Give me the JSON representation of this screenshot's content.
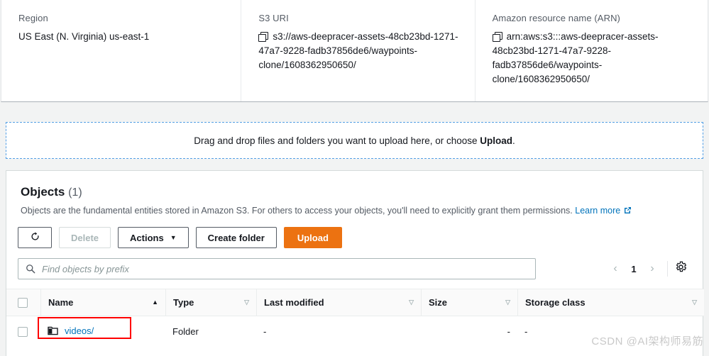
{
  "info": {
    "region": {
      "label": "Region",
      "value": "US East (N. Virginia) us-east-1"
    },
    "s3_uri": {
      "label": "S3 URI",
      "value": "s3://aws-deepracer-assets-48cb23bd-1271-47a7-9228-fadb37856de6/waypoints-clone/1608362950650/",
      "copy_icon": "copy-icon"
    },
    "arn": {
      "label": "Amazon resource name (ARN)",
      "value": "arn:aws:s3:::aws-deepracer-assets-48cb23bd-1271-47a7-9228-fadb37856de6/waypoints-clone/1608362950650/",
      "copy_icon": "copy-icon"
    }
  },
  "dropzone": {
    "text_before": "Drag and drop files and folders you want to upload here, or choose ",
    "emphasis": "Upload",
    "text_after": "."
  },
  "objects": {
    "title": "Objects",
    "count": "(1)",
    "description": "Objects are the fundamental entities stored in Amazon S3. For others to access your objects, you'll need to explicitly grant them permissions.",
    "learn_more": "Learn more",
    "toolbar": {
      "refresh_icon": "refresh-icon",
      "delete_label": "Delete",
      "actions_label": "Actions",
      "actions_caret": "▼",
      "create_folder_label": "Create folder",
      "upload_label": "Upload"
    },
    "search": {
      "placeholder": "Find objects by prefix",
      "value": "",
      "icon": "search-icon"
    },
    "pagination": {
      "prev": "‹",
      "page": "1",
      "next": "›",
      "settings_icon": "gear-icon"
    },
    "table": {
      "columns": [
        {
          "label": "Name",
          "sort": "asc",
          "sort_glyph": "▲"
        },
        {
          "label": "Type",
          "sort": "none",
          "sort_glyph": "▽"
        },
        {
          "label": "Last modified",
          "sort": "none",
          "sort_glyph": "▽"
        },
        {
          "label": "Size",
          "sort": "none",
          "sort_glyph": "▽"
        },
        {
          "label": "Storage class",
          "sort": "none",
          "sort_glyph": "▽"
        }
      ],
      "rows": [
        {
          "name": "videos/",
          "name_icon": "folder-icon",
          "type": "Folder",
          "last_modified": "-",
          "size": "-",
          "storage_class": "-",
          "highlighted": true
        }
      ]
    }
  },
  "watermark": "CSDN @AI架构师易筋",
  "colors": {
    "link": "#0073bb",
    "primary_button": "#ec7211",
    "dropzone_border": "#539fe5",
    "highlight": "#ff0000",
    "page_bg": "#f2f3f3"
  }
}
